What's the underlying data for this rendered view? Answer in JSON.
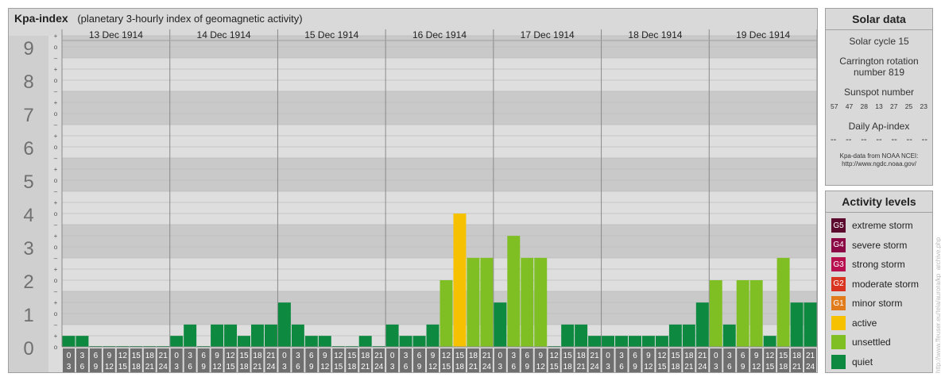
{
  "header": {
    "title": "Kpa-index",
    "subtitle": "(planetary 3-hourly index of geomagnetic activity)"
  },
  "chart_data": {
    "type": "bar",
    "title": "Kpa-index",
    "subtitle": "(planetary 3-hourly index of geomagnetic activity)",
    "ylim": [
      0,
      9.33
    ],
    "y_major_ticks": [
      "0",
      "1",
      "2",
      "3",
      "4",
      "5",
      "6",
      "7",
      "8",
      "9"
    ],
    "y_minor_ticks": [
      "o",
      "+",
      "–"
    ],
    "days": [
      "13 Dec 1914",
      "14 Dec 1914",
      "15 Dec 1914",
      "16 Dec 1914",
      "17 Dec 1914",
      "18 Dec 1914",
      "19 Dec 1914"
    ],
    "interval_start_hours": [
      "0",
      "3",
      "6",
      "9",
      "12",
      "15",
      "18",
      "21"
    ],
    "interval_end_hours": [
      "3",
      "6",
      "9",
      "12",
      "15",
      "18",
      "21",
      "24"
    ],
    "values": [
      [
        0.33,
        0.33,
        0.0,
        0.0,
        0.0,
        0.0,
        0.0,
        0.0
      ],
      [
        0.33,
        0.67,
        0.0,
        0.67,
        0.67,
        0.33,
        0.67,
        0.67
      ],
      [
        1.33,
        0.67,
        0.33,
        0.33,
        0.0,
        0.0,
        0.33,
        0.0
      ],
      [
        0.67,
        0.33,
        0.33,
        0.67,
        2.0,
        4.0,
        2.67,
        2.67
      ],
      [
        1.33,
        3.33,
        2.67,
        2.67,
        0.0,
        0.67,
        0.67,
        0.33
      ],
      [
        0.33,
        0.33,
        0.33,
        0.33,
        0.33,
        0.67,
        0.67,
        1.33
      ],
      [
        2.0,
        0.67,
        2.0,
        2.0,
        0.33,
        2.67,
        1.33,
        1.33
      ]
    ],
    "level_thresholds": {
      "unsettled": 1.67,
      "active": 3.67,
      "G1": 4.67
    },
    "grid": true
  },
  "solar": {
    "header": "Solar data",
    "cycle": "Solar cycle 15",
    "carrington_line1": "Carrington rotation",
    "carrington_line2": "number 819",
    "sunspot_label": "Sunspot number",
    "sunspot_values": [
      "57",
      "47",
      "28",
      "13",
      "27",
      "25",
      "23"
    ],
    "ap_label": "Daily Ap-index",
    "ap_values": [
      "--",
      "--",
      "--",
      "--",
      "--",
      "--",
      "--"
    ],
    "credit_line1": "Kpa-data from NOAA NCEI:",
    "credit_line2": "http://www.ngdc.noaa.gov/"
  },
  "activity": {
    "header": "Activity levels",
    "levels": [
      {
        "badge": "G5",
        "label": "extreme storm",
        "color": "#5c0a2e"
      },
      {
        "badge": "G4",
        "label": "severe storm",
        "color": "#8b0a45"
      },
      {
        "badge": "G3",
        "label": "strong storm",
        "color": "#b8104f"
      },
      {
        "badge": "G2",
        "label": "moderate storm",
        "color": "#d9341f"
      },
      {
        "badge": "G1",
        "label": "minor storm",
        "color": "#e07c1c"
      },
      {
        "badge": "",
        "label": "active",
        "color": "#f6c100"
      },
      {
        "badge": "",
        "label": "unsettled",
        "color": "#7fbf23"
      },
      {
        "badge": "",
        "label": "quiet",
        "color": "#0e8a40"
      }
    ]
  },
  "watermark": "http://www.ffeuser.eu/tela/aurora/kp_archive.php"
}
